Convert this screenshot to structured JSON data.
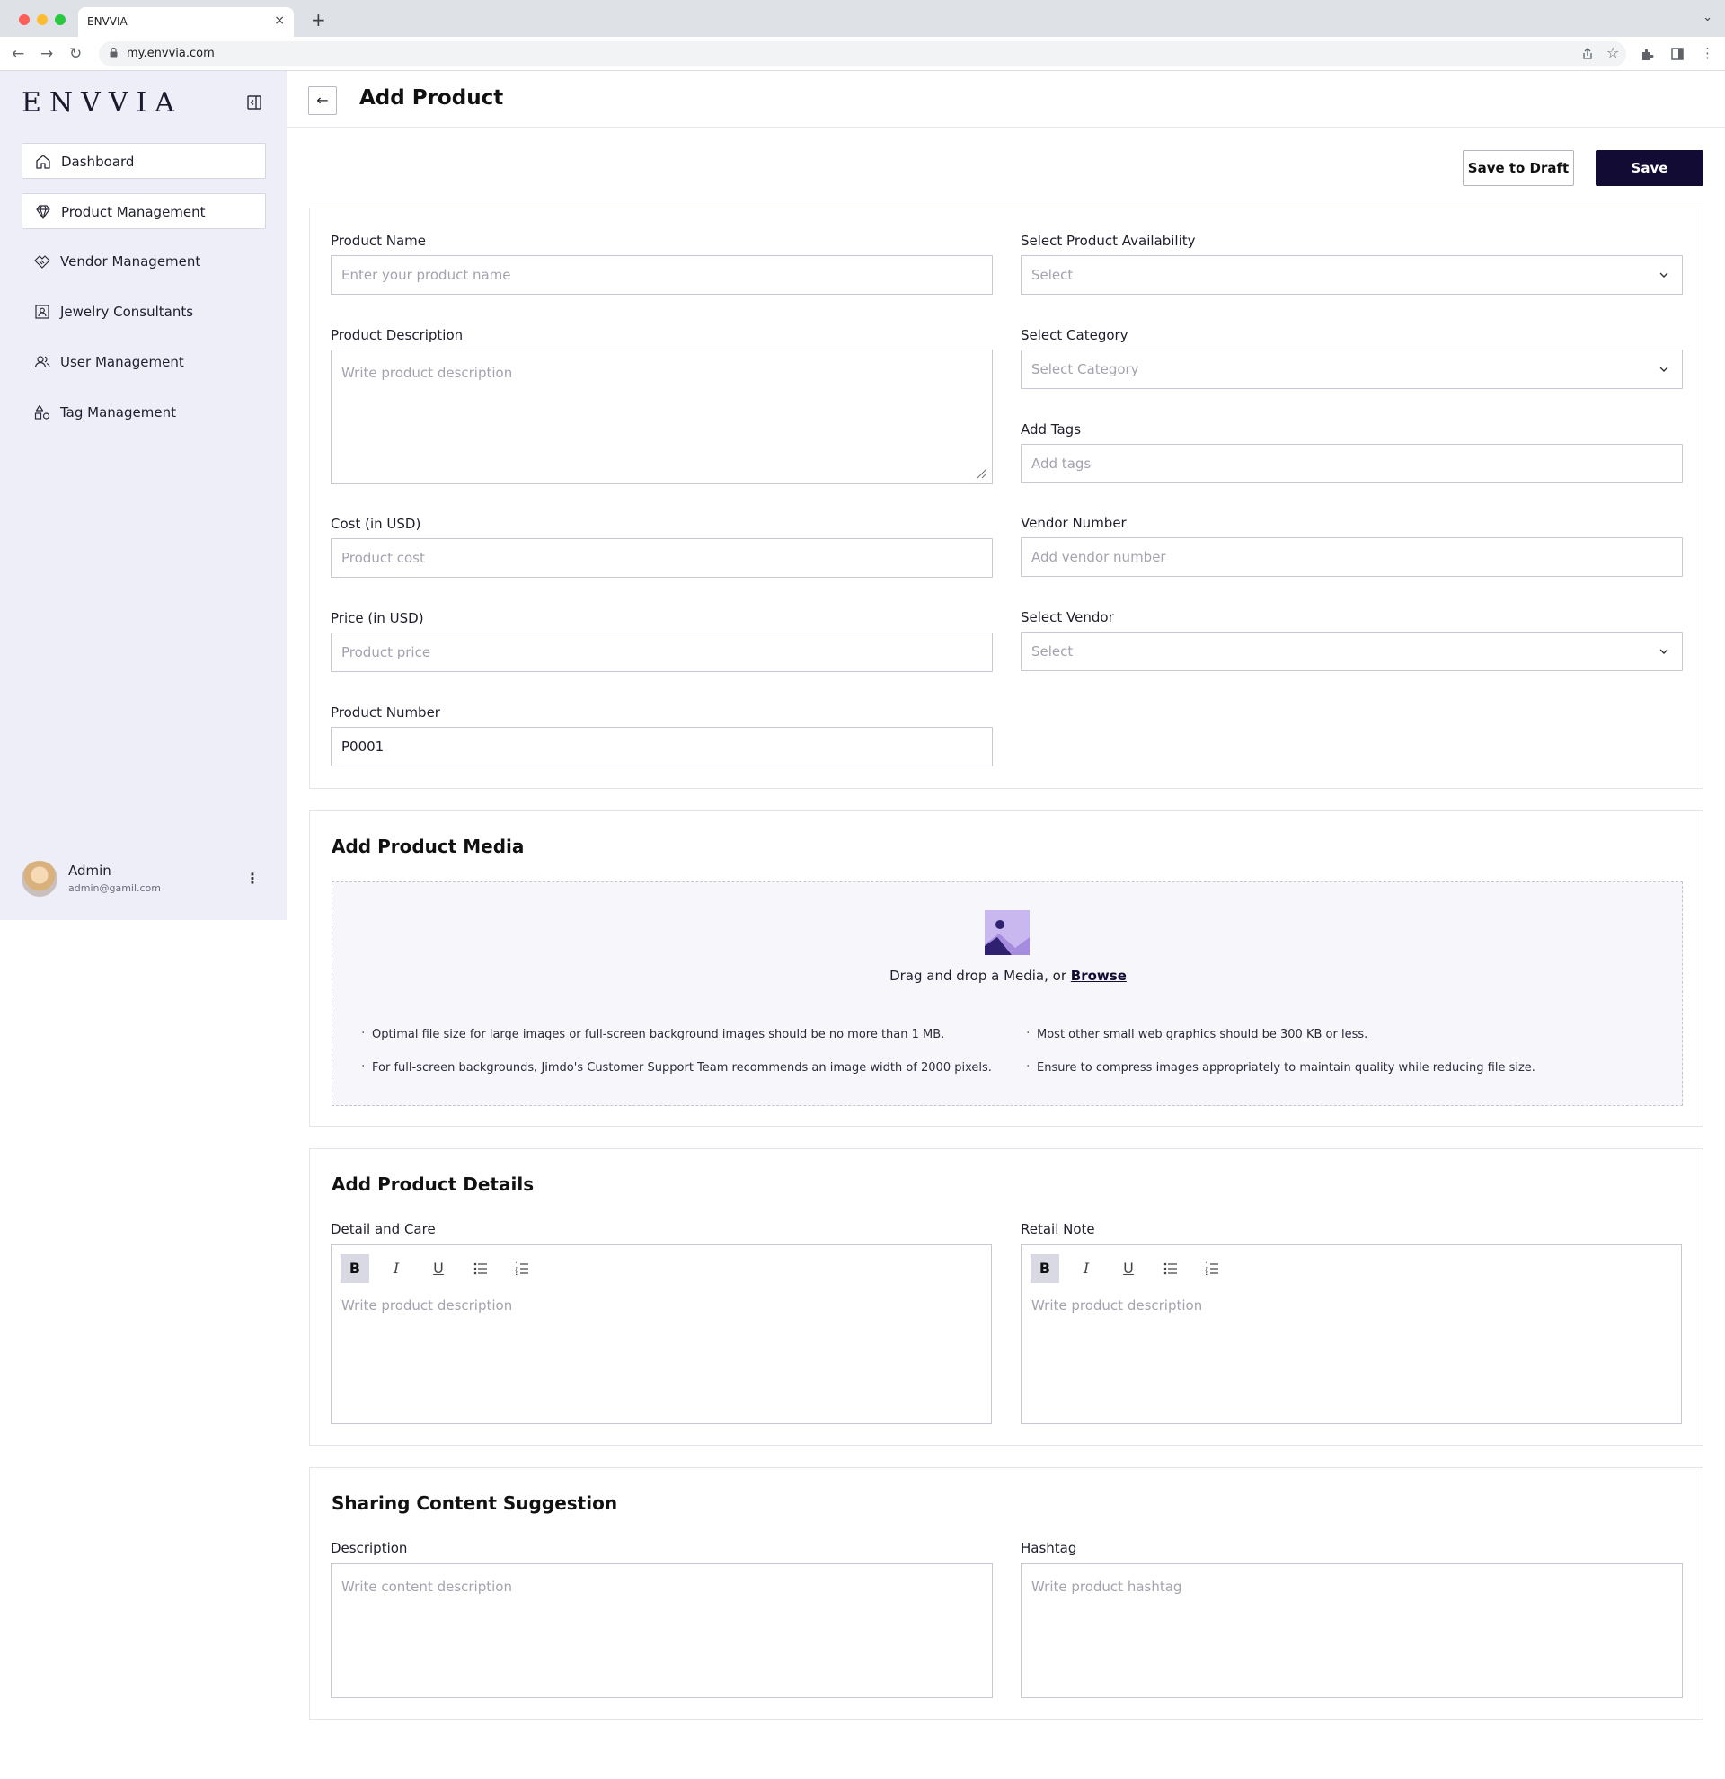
{
  "browser": {
    "tab_title": "ENVVIA",
    "tab_close": "×",
    "new_tab": "+",
    "tab_menu": "⌄",
    "url": "my.envvia.com",
    "back": "←",
    "forward": "→",
    "reload": "↻",
    "star": "☆",
    "kebab": "⋮"
  },
  "sidebar": {
    "logo": "ENVVIA",
    "items": [
      {
        "label": "Dashboard",
        "icon": "home-icon"
      },
      {
        "label": "Product Management",
        "icon": "diamond-icon"
      },
      {
        "label": "Vendor Management",
        "icon": "handshake-icon"
      },
      {
        "label": "Jewelry Consultants",
        "icon": "contact-card-icon"
      },
      {
        "label": "User Management",
        "icon": "users-icon"
      },
      {
        "label": "Tag Management",
        "icon": "shapes-icon"
      }
    ],
    "user": {
      "name": "Admin",
      "email": "admin@gamil.com",
      "menu": "⋮"
    }
  },
  "header": {
    "back": "←",
    "title": "Add Product"
  },
  "actions": {
    "draft_label": "Save to Draft",
    "save_label": "Save"
  },
  "product_form": {
    "name": {
      "label": "Product Name",
      "placeholder": "Enter your product name"
    },
    "availability": {
      "label": "Select Product Availability",
      "placeholder": "Select"
    },
    "description": {
      "label": "Product Description",
      "placeholder": "Write product description"
    },
    "category": {
      "label": "Select Category",
      "placeholder": "Select Category"
    },
    "tags": {
      "label": "Add Tags",
      "placeholder": "Add tags"
    },
    "cost": {
      "label": "Cost (in USD)",
      "placeholder": "Product cost"
    },
    "vendor_number": {
      "label": "Vendor Number",
      "placeholder": "Add vendor number"
    },
    "price": {
      "label": "Price (in USD)",
      "placeholder": "Product price"
    },
    "vendor": {
      "label": "Select Vendor",
      "placeholder": "Select"
    },
    "product_number": {
      "label": "Product Number",
      "value": "P0001"
    }
  },
  "media": {
    "title": "Add Product Media",
    "drop_text": "Drag and drop a Media, or ",
    "browse": "Browse",
    "tips": [
      "Optimal file size for large images or full-screen background images should be no more than 1 MB.",
      "Most other small web graphics should be 300 KB or less.",
      "For full-screen backgrounds, Jimdo's Customer Support Team recommends an image width of 2000 pixels.",
      "Ensure to compress images appropriately to maintain quality while reducing file size."
    ]
  },
  "details": {
    "title": "Add Product Details",
    "detail_care": {
      "label": "Detail and Care",
      "placeholder": "Write product description"
    },
    "retail_note": {
      "label": "Retail Note",
      "placeholder": "Write product description"
    },
    "toolbar": {
      "bold": "B",
      "italic": "I",
      "underline": "U"
    }
  },
  "sharing": {
    "title": "Sharing Content Suggestion",
    "description": {
      "label": "Description",
      "placeholder": "Write content description"
    },
    "hashtag": {
      "label": "Hashtag",
      "placeholder": "Write product hashtag"
    }
  },
  "colors": {
    "primary": "#120b34",
    "sidebar_bg": "#eeeef9",
    "accent_purple": "#a78bdb"
  }
}
